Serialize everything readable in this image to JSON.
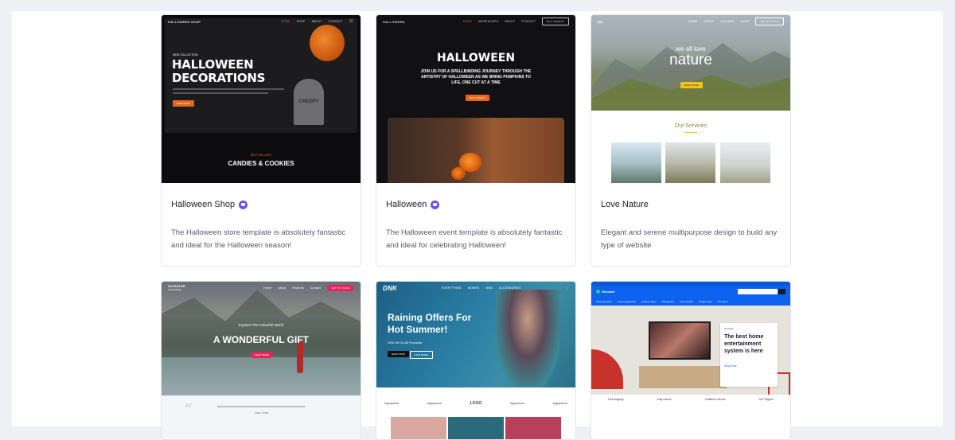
{
  "templates": [
    {
      "title": "Halloween Shop",
      "premium": true,
      "description": "The Halloween store template is absolutely fantastic and ideal for the Halloween season!",
      "preview": {
        "brand": "HALLOWEEN SHOP",
        "nav": [
          "HOME",
          "SHOP",
          "ABOUT",
          "CONTACT"
        ],
        "eyebrow": "NEW COLLECTION",
        "hero_line1": "HALLOWEEN",
        "hero_line2": "DECORATIONS",
        "cta": "SHOP NOW",
        "tombstone": "CREEPY",
        "section_eyebrow": "BEST SELLERS",
        "section_title": "CANDIES & COOKIES"
      }
    },
    {
      "title": "Halloween",
      "premium": true,
      "description": "The Halloween event template is absolutely fantastic and ideal for celebrating Halloween!",
      "preview": {
        "brand": "HALLOWEEN",
        "nav": [
          "HOME",
          "WORKSHOPS",
          "ABOUT",
          "CONTACT"
        ],
        "nav_button": "BUY TICKETS",
        "hero_title": "HALLOWEEN",
        "hero_text": "JOIN US FOR A SPELLBINDING JOURNEY THROUGH THE ARTISTRY OF HALLOWEEN AS WE BRING PUMPKINS TO LIFE, ONE CUT AT A TIME",
        "cta": "BUY TICKETS"
      }
    },
    {
      "title": "Love Nature",
      "premium": false,
      "description": "Elegant and serene multipurpose design to build any type of website",
      "preview": {
        "nav": [
          "HOME",
          "ABOUT",
          "GALLERY",
          "BLOG"
        ],
        "nav_button": "GET IN TOUCH",
        "hero_small": "we all love",
        "hero_big": "nature",
        "cta": "READ MORE",
        "section_title": "Our Services"
      }
    },
    {
      "preview": {
        "brand_line1": "OUTDOOR",
        "brand_line2": "ADVENTURE",
        "nav": [
          "Home",
          "About",
          "Projects",
          "Contact"
        ],
        "nav_button": "GET IN TOUCH",
        "hero_small": "Explore The Colourful World",
        "hero_big": "A WONDERFUL GIFT",
        "cta": "READ MORE",
        "quote_author": "- Alan Smith"
      }
    },
    {
      "preview": {
        "brand": "DNK",
        "nav": [
          "EVERYTHING",
          "WOMEN",
          "MEN",
          "ACCESSORIES"
        ],
        "hero_line1": "Raining Offers For",
        "hero_line2": "Hot Summer!",
        "hero_sub": "25% Off On All Products",
        "btn1": "SHOP NOW",
        "btn2": "FIND MORE",
        "logos": [
          "logoipsum",
          "logoipsum",
          "LOGO",
          "logoipsum",
          "logoipsum"
        ]
      }
    },
    {
      "preview": {
        "brand": "Homeart",
        "categories": [
          "Shop by Brand",
          "Home appliances",
          "Audio & video",
          "Refrigerator",
          "New arrivals",
          "Today's deal",
          "Gift cards"
        ],
        "promo_brand": "Homeart",
        "promo_title": "The best home entertainment system is here",
        "promo_link": "Shop now",
        "features": [
          "Free shipping",
          "Easy returns",
          "Certified & Secure",
          "24/7 Support"
        ]
      }
    }
  ]
}
